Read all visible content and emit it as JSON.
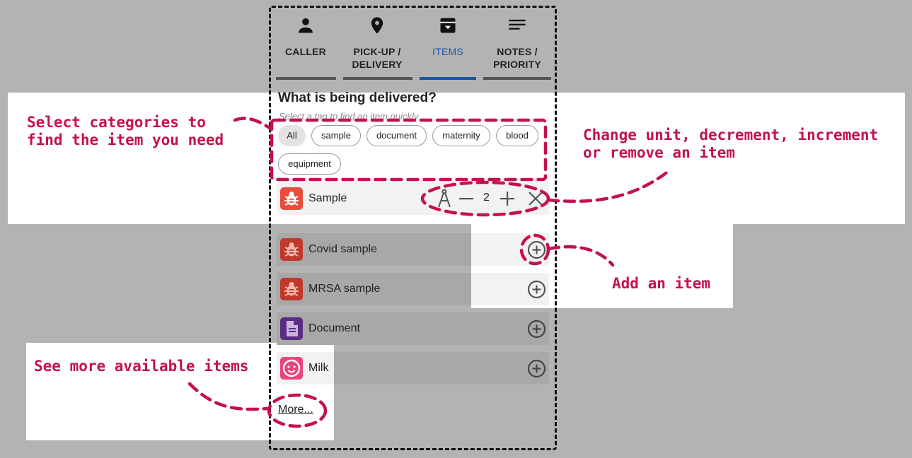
{
  "tabs": [
    {
      "label": "CALLER",
      "icon": "person-icon",
      "active": false
    },
    {
      "label": "PICK-UP / DELIVERY",
      "line1": "PICK-UP /",
      "line2": "DELIVERY",
      "icon": "location-pin-icon",
      "active": false
    },
    {
      "label": "ITEMS",
      "icon": "archive-box-icon",
      "active": true
    },
    {
      "label": "NOTES / PRIORITY",
      "line1": "NOTES /",
      "line2": "PRIORITY",
      "icon": "notes-lines-icon",
      "active": false
    }
  ],
  "section": {
    "title": "What is being delivered?",
    "hint": "Select a tag to find an item quickly"
  },
  "tags": [
    "All",
    "sample",
    "document",
    "maternity",
    "blood",
    "equipment"
  ],
  "selected_tag": "All",
  "selected_item": {
    "name": "Sample",
    "quantity": "2",
    "icon": "bug-icon"
  },
  "items": [
    {
      "name": "Covid sample",
      "icon": "bug-icon"
    },
    {
      "name": "MRSA sample",
      "icon": "bug-icon"
    },
    {
      "name": "Document",
      "icon": "document-icon"
    },
    {
      "name": "Milk",
      "icon": "baby-face-icon"
    }
  ],
  "more_link": "More...",
  "annotations": {
    "categories": "Select categories to\nfind the item you need",
    "controls": "Change unit, decrement, increment\nor remove an item",
    "add": "Add an item",
    "more": "See more available items"
  },
  "colors": {
    "accent": "#1a56a6",
    "annotation": "#c4114f",
    "bug_badge": "#c0392b",
    "bug_badge_active": "#e74c3c",
    "document_badge": "#5b2c83",
    "milk_badge": "#e8457a"
  }
}
